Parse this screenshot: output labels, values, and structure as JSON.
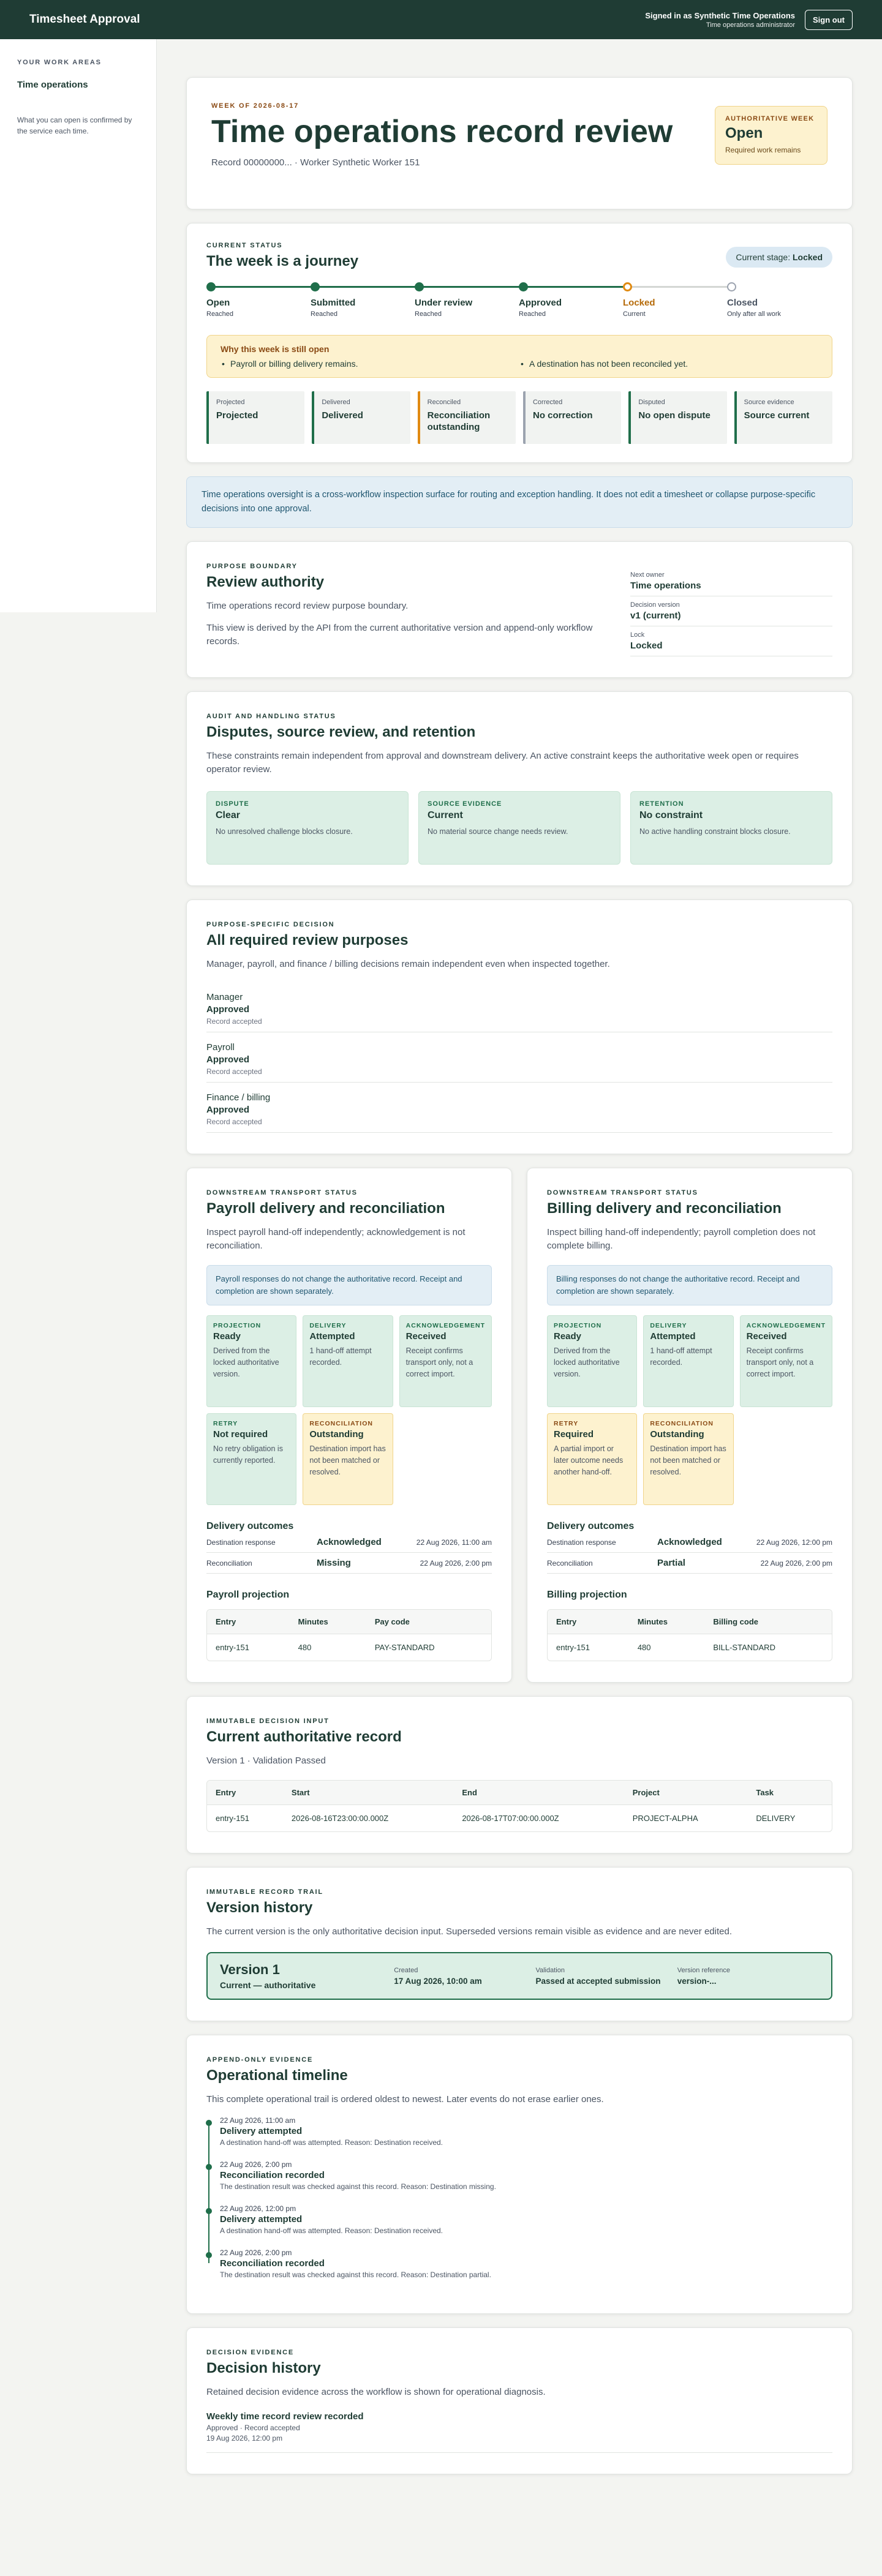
{
  "topbar": {
    "title": "Timesheet Approval",
    "signed_in": "Signed in as Synthetic Time Operations",
    "role": "Time operations administrator",
    "sign_out": "Sign out"
  },
  "sidebar": {
    "heading": "YOUR WORK AREAS",
    "item": "Time operations",
    "note": "What you can open is confirmed by the service each time."
  },
  "hero": {
    "eyebrow": "WEEK OF 2026-08-17",
    "title": "Time operations record review",
    "meta": "Record 00000000... · Worker Synthetic Worker 151",
    "auth_label": "AUTHORITATIVE WEEK",
    "auth_value": "Open",
    "auth_note": "Required work remains"
  },
  "journey": {
    "eyebrow": "CURRENT STATUS",
    "title": "The week is a journey",
    "stage_label": "Current stage:",
    "stage_value": "Locked",
    "steps": [
      {
        "label": "Open",
        "status": "Reached"
      },
      {
        "label": "Submitted",
        "status": "Reached"
      },
      {
        "label": "Under review",
        "status": "Reached"
      },
      {
        "label": "Approved",
        "status": "Reached"
      },
      {
        "label": "Locked",
        "status": "Current"
      },
      {
        "label": "Closed",
        "status": "Only after all work"
      }
    ],
    "still_title": "Why this week is still open",
    "still_items": [
      "Payroll or billing delivery remains.",
      "A destination has not been reconciled yet."
    ],
    "dims": [
      {
        "k": "Projected",
        "v": "Projected"
      },
      {
        "k": "Delivered",
        "v": "Delivered"
      },
      {
        "k": "Reconciled",
        "v": "Reconciliation outstanding"
      },
      {
        "k": "Corrected",
        "v": "No correction"
      },
      {
        "k": "Disputed",
        "v": "No open dispute"
      },
      {
        "k": "Source evidence",
        "v": "Source current"
      }
    ]
  },
  "notice": "Time operations oversight is a cross-workflow inspection surface for routing and exception handling. It does not edit a timesheet or collapse purpose-specific decisions into one approval.",
  "purpose": {
    "eyebrow": "PURPOSE BOUNDARY",
    "title": "Review authority",
    "p1": "Time operations record review purpose boundary.",
    "p2": "This view is derived by the API from the current authoritative version and append-only workflow records.",
    "kv": [
      {
        "k": "Next owner",
        "v": "Time operations"
      },
      {
        "k": "Decision version",
        "v": "v1 (current)"
      },
      {
        "k": "Lock",
        "v": "Locked"
      }
    ]
  },
  "disputes": {
    "eyebrow": "AUDIT AND HANDLING STATUS",
    "title": "Disputes, source review, and retention",
    "p": "These constraints remain independent from approval and downstream delivery. An active constraint keeps the authoritative week open or requires operator review.",
    "boxes": [
      {
        "k": "DISPUTE",
        "v": "Clear",
        "n": "No unresolved challenge blocks closure."
      },
      {
        "k": "SOURCE EVIDENCE",
        "v": "Current",
        "n": "No material source change needs review."
      },
      {
        "k": "RETENTION",
        "v": "No constraint",
        "n": "No active handling constraint blocks closure."
      }
    ]
  },
  "reviews": {
    "eyebrow": "PURPOSE-SPECIFIC DECISION",
    "title": "All required review purposes",
    "p": "Manager, payroll, and finance / billing decisions remain independent even when inspected together.",
    "items": [
      {
        "name": "Manager",
        "status": "Approved",
        "note": "Record accepted"
      },
      {
        "name": "Payroll",
        "status": "Approved",
        "note": "Record accepted"
      },
      {
        "name": "Finance / billing",
        "status": "Approved",
        "note": "Record accepted"
      }
    ]
  },
  "payroll": {
    "eyebrow": "DOWNSTREAM TRANSPORT STATUS",
    "title": "Payroll delivery and reconciliation",
    "p": "Inspect payroll hand-off independently; acknowledgement is not reconciliation.",
    "info": "Payroll responses do not change the authoritative record. Receipt and completion are shown separately.",
    "boxes": [
      {
        "k": "PROJECTION",
        "v": "Ready",
        "n": "Derived from the locked authoritative version."
      },
      {
        "k": "DELIVERY",
        "v": "Attempted",
        "n": "1 hand-off attempt recorded."
      },
      {
        "k": "ACKNOWLEDGEMENT",
        "v": "Received",
        "n": "Receipt confirms transport only, not a correct import."
      },
      {
        "k": "RETRY",
        "v": "Not required",
        "n": "No retry obligation is currently reported."
      },
      {
        "k": "RECONCILIATION",
        "v": "Outstanding",
        "n": "Destination import has not been matched or resolved."
      }
    ],
    "outcomes_title": "Delivery outcomes",
    "outcomes": [
      {
        "a": "Destination response",
        "b": "Acknowledged",
        "c": "22 Aug 2026, 11:00 am"
      },
      {
        "a": "Reconciliation",
        "b": "Missing",
        "c": "22 Aug 2026, 2:00 pm"
      }
    ],
    "proj_title": "Payroll projection",
    "cols": [
      "Entry",
      "Minutes",
      "Pay code"
    ],
    "rows": [
      [
        "entry-151",
        "480",
        "PAY-STANDARD"
      ]
    ]
  },
  "billing": {
    "eyebrow": "DOWNSTREAM TRANSPORT STATUS",
    "title": "Billing delivery and reconciliation",
    "p": "Inspect billing hand-off independently; payroll completion does not complete billing.",
    "info": "Billing responses do not change the authoritative record. Receipt and completion are shown separately.",
    "boxes": [
      {
        "k": "PROJECTION",
        "v": "Ready",
        "n": "Derived from the locked authoritative version."
      },
      {
        "k": "DELIVERY",
        "v": "Attempted",
        "n": "1 hand-off attempt recorded."
      },
      {
        "k": "ACKNOWLEDGEMENT",
        "v": "Received",
        "n": "Receipt confirms transport only, not a correct import."
      },
      {
        "k": "RETRY",
        "v": "Required",
        "n": "A partial import or later outcome needs another hand-off."
      },
      {
        "k": "RECONCILIATION",
        "v": "Outstanding",
        "n": "Destination import has not been matched or resolved."
      }
    ],
    "outcomes_title": "Delivery outcomes",
    "outcomes": [
      {
        "a": "Destination response",
        "b": "Acknowledged",
        "c": "22 Aug 2026, 12:00 pm"
      },
      {
        "a": "Reconciliation",
        "b": "Partial",
        "c": "22 Aug 2026, 2:00 pm"
      }
    ],
    "proj_title": "Billing projection",
    "cols": [
      "Entry",
      "Minutes",
      "Billing code"
    ],
    "rows": [
      [
        "entry-151",
        "480",
        "BILL-STANDARD"
      ]
    ]
  },
  "record": {
    "eyebrow": "IMMUTABLE DECISION INPUT",
    "title": "Current authoritative record",
    "p": "Version 1 · Validation Passed",
    "cols": [
      "Entry",
      "Start",
      "End",
      "Project",
      "Task"
    ],
    "rows": [
      [
        "entry-151",
        "2026-08-16T23:00:00.000Z",
        "2026-08-17T07:00:00.000Z",
        "PROJECT-ALPHA",
        "DELIVERY"
      ]
    ]
  },
  "version": {
    "eyebrow": "IMMUTABLE RECORD TRAIL",
    "title": "Version history",
    "p": "The current version is the only authoritative decision input. Superseded versions remain visible as evidence and are never edited.",
    "name": "Version 1",
    "state": "Current — authoritative",
    "cols": [
      {
        "k": "Created",
        "v": "17 Aug 2026, 10:00 am"
      },
      {
        "k": "Validation",
        "v": "Passed at accepted submission"
      },
      {
        "k": "Version reference",
        "v": "version-..."
      }
    ]
  },
  "timeline": {
    "eyebrow": "APPEND-ONLY EVIDENCE",
    "title": "Operational timeline",
    "p": "This complete operational trail is ordered oldest to newest. Later events do not erase earlier ones.",
    "events": [
      {
        "ts": "22 Aug 2026, 11:00 am",
        "title": "Delivery attempted",
        "desc": "A destination hand-off was attempted. Reason: Destination received."
      },
      {
        "ts": "22 Aug 2026, 2:00 pm",
        "title": "Reconciliation recorded",
        "desc": "The destination result was checked against this record. Reason: Destination missing."
      },
      {
        "ts": "22 Aug 2026, 12:00 pm",
        "title": "Delivery attempted",
        "desc": "A destination hand-off was attempted. Reason: Destination received."
      },
      {
        "ts": "22 Aug 2026, 2:00 pm",
        "title": "Reconciliation recorded",
        "desc": "The destination result was checked against this record. Reason: Destination partial."
      }
    ]
  },
  "decisions": {
    "eyebrow": "DECISION EVIDENCE",
    "title": "Decision history",
    "p": "Retained decision evidence across the workflow is shown for operational diagnosis.",
    "item_title": "Weekly time record review recorded",
    "item_status": "Approved · Record accepted",
    "item_time": "19 Aug 2026, 12:00 pm"
  }
}
